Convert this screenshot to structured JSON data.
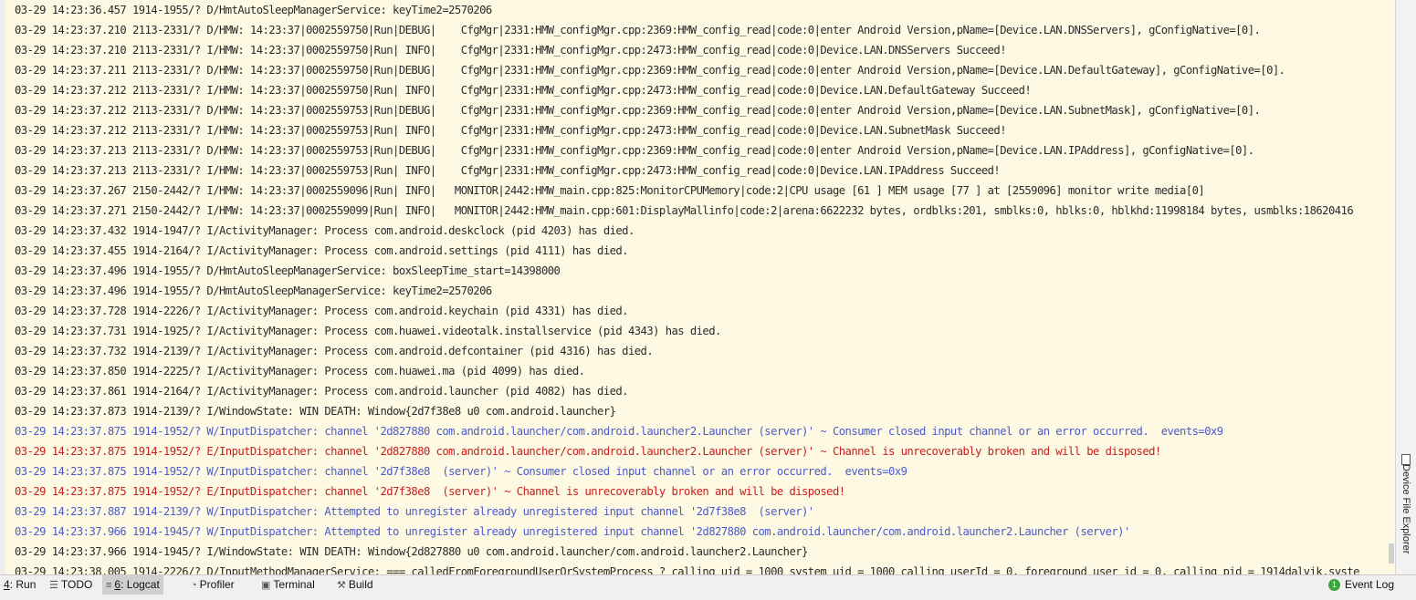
{
  "log_lines": [
    {
      "level": "D",
      "text": "03-29 14:23:36.457 1914-1955/? D/HmtAutoSleepManagerService: keyTime2=2570206"
    },
    {
      "level": "D",
      "text": "03-29 14:23:37.210 2113-2331/? D/HMW: 14:23:37|0002559750|Run|DEBUG|    CfgMgr|2331:HMW_configMgr.cpp:2369:HMW_config_read|code:0|enter Android Version,pName=[Device.LAN.DNSServers], gConfigNative=[0]."
    },
    {
      "level": "I",
      "text": "03-29 14:23:37.210 2113-2331/? I/HMW: 14:23:37|0002559750|Run| INFO|    CfgMgr|2331:HMW_configMgr.cpp:2473:HMW_config_read|code:0|Device.LAN.DNSServers Succeed!"
    },
    {
      "level": "D",
      "text": "03-29 14:23:37.211 2113-2331/? D/HMW: 14:23:37|0002559750|Run|DEBUG|    CfgMgr|2331:HMW_configMgr.cpp:2369:HMW_config_read|code:0|enter Android Version,pName=[Device.LAN.DefaultGateway], gConfigNative=[0]."
    },
    {
      "level": "I",
      "text": "03-29 14:23:37.212 2113-2331/? I/HMW: 14:23:37|0002559750|Run| INFO|    CfgMgr|2331:HMW_configMgr.cpp:2473:HMW_config_read|code:0|Device.LAN.DefaultGateway Succeed!"
    },
    {
      "level": "D",
      "text": "03-29 14:23:37.212 2113-2331/? D/HMW: 14:23:37|0002559753|Run|DEBUG|    CfgMgr|2331:HMW_configMgr.cpp:2369:HMW_config_read|code:0|enter Android Version,pName=[Device.LAN.SubnetMask], gConfigNative=[0]."
    },
    {
      "level": "I",
      "text": "03-29 14:23:37.212 2113-2331/? I/HMW: 14:23:37|0002559753|Run| INFO|    CfgMgr|2331:HMW_configMgr.cpp:2473:HMW_config_read|code:0|Device.LAN.SubnetMask Succeed!"
    },
    {
      "level": "D",
      "text": "03-29 14:23:37.213 2113-2331/? D/HMW: 14:23:37|0002559753|Run|DEBUG|    CfgMgr|2331:HMW_configMgr.cpp:2369:HMW_config_read|code:0|enter Android Version,pName=[Device.LAN.IPAddress], gConfigNative=[0]."
    },
    {
      "level": "I",
      "text": "03-29 14:23:37.213 2113-2331/? I/HMW: 14:23:37|0002559753|Run| INFO|    CfgMgr|2331:HMW_configMgr.cpp:2473:HMW_config_read|code:0|Device.LAN.IPAddress Succeed!"
    },
    {
      "level": "I",
      "text": "03-29 14:23:37.267 2150-2442/? I/HMW: 14:23:37|0002559096|Run| INFO|   MONITOR|2442:HMW_main.cpp:825:MonitorCPUMemory|code:2|CPU usage [61 ] MEM usage [77 ] at [2559096] monitor write media[0]"
    },
    {
      "level": "I",
      "text": "03-29 14:23:37.271 2150-2442/? I/HMW: 14:23:37|0002559099|Run| INFO|   MONITOR|2442:HMW_main.cpp:601:DisplayMallinfo|code:2|arena:6622232 bytes, ordblks:201, smblks:0, hblks:0, hblkhd:11998184 bytes, usmblks:18620416"
    },
    {
      "level": "I",
      "text": "03-29 14:23:37.432 1914-1947/? I/ActivityManager: Process com.android.deskclock (pid 4203) has died."
    },
    {
      "level": "I",
      "text": "03-29 14:23:37.455 1914-2164/? I/ActivityManager: Process com.android.settings (pid 4111) has died."
    },
    {
      "level": "D",
      "text": "03-29 14:23:37.496 1914-1955/? D/HmtAutoSleepManagerService: boxSleepTime_start=14398000"
    },
    {
      "level": "D",
      "text": "03-29 14:23:37.496 1914-1955/? D/HmtAutoSleepManagerService: keyTime2=2570206"
    },
    {
      "level": "I",
      "text": "03-29 14:23:37.728 1914-2226/? I/ActivityManager: Process com.android.keychain (pid 4331) has died."
    },
    {
      "level": "I",
      "text": "03-29 14:23:37.731 1914-1925/? I/ActivityManager: Process com.huawei.videotalk.installservice (pid 4343) has died."
    },
    {
      "level": "I",
      "text": "03-29 14:23:37.732 1914-2139/? I/ActivityManager: Process com.android.defcontainer (pid 4316) has died."
    },
    {
      "level": "I",
      "text": "03-29 14:23:37.850 1914-2225/? I/ActivityManager: Process com.huawei.ma (pid 4099) has died."
    },
    {
      "level": "I",
      "text": "03-29 14:23:37.861 1914-2164/? I/ActivityManager: Process com.android.launcher (pid 4082) has died."
    },
    {
      "level": "I",
      "text": "03-29 14:23:37.873 1914-2139/? I/WindowState: WIN DEATH: Window{2d7f38e8 u0 com.android.launcher}"
    },
    {
      "level": "W",
      "text": "03-29 14:23:37.875 1914-1952/? W/InputDispatcher: channel '2d827880 com.android.launcher/com.android.launcher2.Launcher (server)' ~ Consumer closed input channel or an error occurred.  events=0x9"
    },
    {
      "level": "E",
      "text": "03-29 14:23:37.875 1914-1952/? E/InputDispatcher: channel '2d827880 com.android.launcher/com.android.launcher2.Launcher (server)' ~ Channel is unrecoverably broken and will be disposed!"
    },
    {
      "level": "W",
      "text": "03-29 14:23:37.875 1914-1952/? W/InputDispatcher: channel '2d7f38e8  (server)' ~ Consumer closed input channel or an error occurred.  events=0x9"
    },
    {
      "level": "E",
      "text": "03-29 14:23:37.875 1914-1952/? E/InputDispatcher: channel '2d7f38e8  (server)' ~ Channel is unrecoverably broken and will be disposed!"
    },
    {
      "level": "W",
      "text": "03-29 14:23:37.887 1914-2139/? W/InputDispatcher: Attempted to unregister already unregistered input channel '2d7f38e8  (server)'"
    },
    {
      "level": "W",
      "text": "03-29 14:23:37.966 1914-1945/? W/InputDispatcher: Attempted to unregister already unregistered input channel '2d827880 com.android.launcher/com.android.launcher2.Launcher (server)'"
    },
    {
      "level": "I",
      "text": "03-29 14:23:37.966 1914-1945/? I/WindowState: WIN DEATH: Window{2d827880 u0 com.android.launcher/com.android.launcher2.Launcher}"
    },
    {
      "level": "D",
      "text": "03-29 14:23:38.005 1914-2226/? D/InputMethodManagerService: === calledFromForegroundUserOrSystemProcess ? calling uid = 1000 system uid = 1000 calling userId = 0, foreground user id = 0, calling pid = 1914dalvik.syste"
    }
  ],
  "bottom_tabs": [
    {
      "key": "4",
      "label": ": Run",
      "icon": "run-icon",
      "glyph": "▶"
    },
    {
      "key": "",
      "label": "TODO",
      "icon": "todo-icon",
      "glyph": "☰"
    },
    {
      "key": "6",
      "label": ": Logcat",
      "icon": "logcat-icon",
      "glyph": "≡"
    },
    {
      "key": "",
      "label": "Profiler",
      "icon": "profiler-icon",
      "glyph": "◔"
    },
    {
      "key": "",
      "label": "Terminal",
      "icon": "terminal-icon",
      "glyph": "▣"
    },
    {
      "key": "",
      "label": "Build",
      "icon": "build-icon",
      "glyph": "⚒"
    }
  ],
  "active_tab": "Logcat",
  "event_log": {
    "label": "Event Log",
    "badge": "1"
  },
  "side_panel": {
    "label": "Device File Explorer"
  },
  "colors": {
    "warn": "#4c5bc9",
    "error": "#c81e1e",
    "text": "#2b2b2b",
    "background": "#fdf9e3",
    "badge": "#3ca63c"
  }
}
